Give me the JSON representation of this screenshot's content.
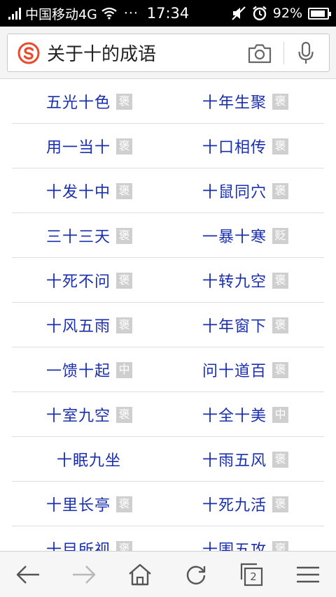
{
  "status_bar": {
    "carrier": "中国移动4G",
    "more": "···",
    "time": "17:34",
    "battery_text": "92%",
    "battery_level": 0.92
  },
  "search": {
    "query": "关于十的成语"
  },
  "idioms": [
    {
      "left": {
        "text": "五光十色",
        "tag": "褒"
      },
      "right": {
        "text": "十年生聚",
        "tag": "褒"
      }
    },
    {
      "left": {
        "text": "用一当十",
        "tag": "褒"
      },
      "right": {
        "text": "十口相传",
        "tag": "褒"
      }
    },
    {
      "left": {
        "text": "十发十中",
        "tag": "褒"
      },
      "right": {
        "text": "十鼠同穴",
        "tag": "褒"
      }
    },
    {
      "left": {
        "text": "三十三天",
        "tag": "褒"
      },
      "right": {
        "text": "一暴十寒",
        "tag": "贬"
      }
    },
    {
      "left": {
        "text": "十死不问",
        "tag": "褒"
      },
      "right": {
        "text": "十转九空",
        "tag": "褒"
      }
    },
    {
      "left": {
        "text": "十风五雨",
        "tag": "褒"
      },
      "right": {
        "text": "十年窗下",
        "tag": "褒"
      }
    },
    {
      "left": {
        "text": "一馈十起",
        "tag": "中"
      },
      "right": {
        "text": "问十道百",
        "tag": "褒"
      }
    },
    {
      "left": {
        "text": "十室九空",
        "tag": "褒"
      },
      "right": {
        "text": "十全十美",
        "tag": "中"
      }
    },
    {
      "left": {
        "text": "十眠九坐",
        "tag": ""
      },
      "right": {
        "text": "十雨五风",
        "tag": "褒"
      }
    },
    {
      "left": {
        "text": "十里长亭",
        "tag": "褒"
      },
      "right": {
        "text": "十死九活",
        "tag": "褒"
      }
    },
    {
      "left": {
        "text": "十目所视",
        "tag": "褒"
      },
      "right": {
        "text": "十围五攻",
        "tag": "褒"
      }
    }
  ],
  "bottom_nav": {
    "tab_count": "2"
  },
  "colors": {
    "idiom_text": "#1a2fb0",
    "tag_bg": "#cfcfcf",
    "logo_red": "#e84a2a"
  },
  "icons": [
    "signal-icon",
    "wifi-icon",
    "mute-icon",
    "alarm-icon",
    "battery-icon",
    "sogou-logo",
    "camera-icon",
    "microphone-icon",
    "back-arrow-icon",
    "forward-arrow-icon",
    "home-icon",
    "refresh-icon",
    "tabs-icon",
    "menu-icon"
  ]
}
